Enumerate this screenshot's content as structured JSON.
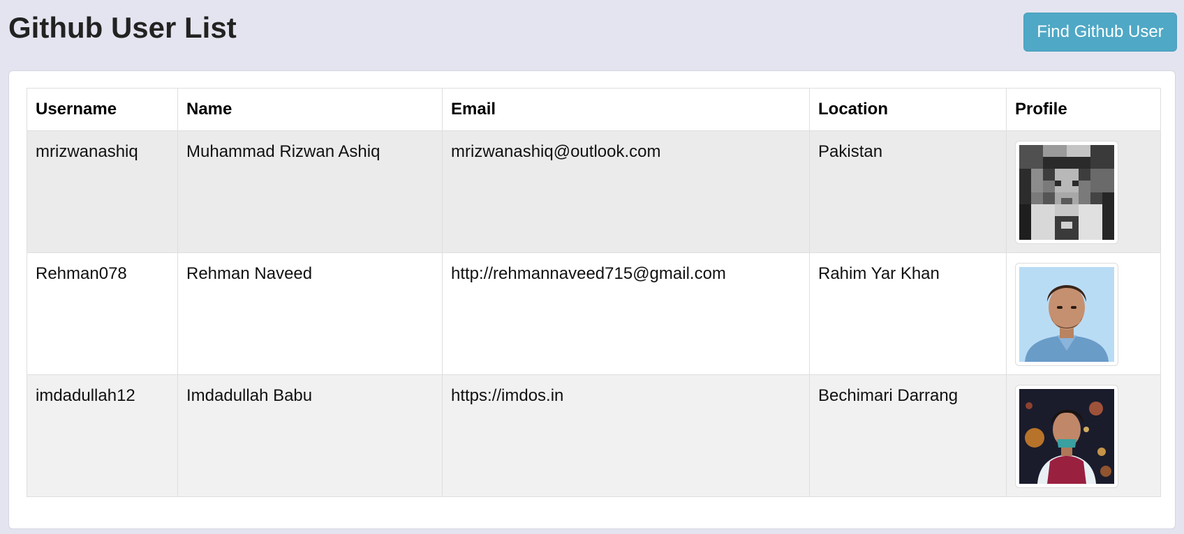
{
  "header": {
    "title": "Github User List",
    "find_button_label": "Find Github User"
  },
  "colors": {
    "page_background": "#e4e4f0",
    "button_accent": "#4fa8c5"
  },
  "table": {
    "columns": [
      "Username",
      "Name",
      "Email",
      "Location",
      "Profile"
    ],
    "rows": [
      {
        "username": "mrizwanashiq",
        "name": "Muhammad Rizwan Ashiq",
        "email": "mrizwanashiq@outlook.com",
        "location": "Pakistan",
        "avatar_icon": "pixelated-grayscale-avatar"
      },
      {
        "username": "Rehman078",
        "name": "Rehman Naveed",
        "email": "http://rehmannaveed715@gmail.com",
        "location": "Rahim Yar Khan",
        "avatar_icon": "portrait-light-blue-avatar"
      },
      {
        "username": "imdadullah12",
        "name": "Imdadullah Babu",
        "email": "https://imdos.in",
        "location": "Bechimari Darrang",
        "avatar_icon": "portrait-night-lights-avatar"
      }
    ]
  }
}
